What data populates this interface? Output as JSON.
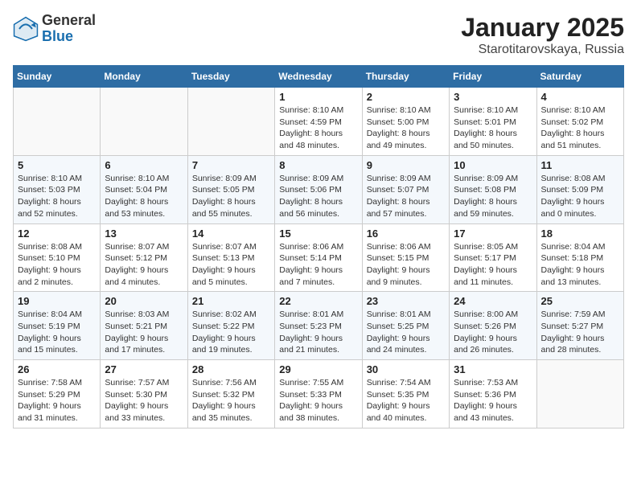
{
  "header": {
    "logo_general": "General",
    "logo_blue": "Blue",
    "month_title": "January 2025",
    "location": "Starotitarovskaya, Russia"
  },
  "weekdays": [
    "Sunday",
    "Monday",
    "Tuesday",
    "Wednesday",
    "Thursday",
    "Friday",
    "Saturday"
  ],
  "weeks": [
    [
      {
        "day": "",
        "info": ""
      },
      {
        "day": "",
        "info": ""
      },
      {
        "day": "",
        "info": ""
      },
      {
        "day": "1",
        "info": "Sunrise: 8:10 AM\nSunset: 4:59 PM\nDaylight: 8 hours\nand 48 minutes."
      },
      {
        "day": "2",
        "info": "Sunrise: 8:10 AM\nSunset: 5:00 PM\nDaylight: 8 hours\nand 49 minutes."
      },
      {
        "day": "3",
        "info": "Sunrise: 8:10 AM\nSunset: 5:01 PM\nDaylight: 8 hours\nand 50 minutes."
      },
      {
        "day": "4",
        "info": "Sunrise: 8:10 AM\nSunset: 5:02 PM\nDaylight: 8 hours\nand 51 minutes."
      }
    ],
    [
      {
        "day": "5",
        "info": "Sunrise: 8:10 AM\nSunset: 5:03 PM\nDaylight: 8 hours\nand 52 minutes."
      },
      {
        "day": "6",
        "info": "Sunrise: 8:10 AM\nSunset: 5:04 PM\nDaylight: 8 hours\nand 53 minutes."
      },
      {
        "day": "7",
        "info": "Sunrise: 8:09 AM\nSunset: 5:05 PM\nDaylight: 8 hours\nand 55 minutes."
      },
      {
        "day": "8",
        "info": "Sunrise: 8:09 AM\nSunset: 5:06 PM\nDaylight: 8 hours\nand 56 minutes."
      },
      {
        "day": "9",
        "info": "Sunrise: 8:09 AM\nSunset: 5:07 PM\nDaylight: 8 hours\nand 57 minutes."
      },
      {
        "day": "10",
        "info": "Sunrise: 8:09 AM\nSunset: 5:08 PM\nDaylight: 8 hours\nand 59 minutes."
      },
      {
        "day": "11",
        "info": "Sunrise: 8:08 AM\nSunset: 5:09 PM\nDaylight: 9 hours\nand 0 minutes."
      }
    ],
    [
      {
        "day": "12",
        "info": "Sunrise: 8:08 AM\nSunset: 5:10 PM\nDaylight: 9 hours\nand 2 minutes."
      },
      {
        "day": "13",
        "info": "Sunrise: 8:07 AM\nSunset: 5:12 PM\nDaylight: 9 hours\nand 4 minutes."
      },
      {
        "day": "14",
        "info": "Sunrise: 8:07 AM\nSunset: 5:13 PM\nDaylight: 9 hours\nand 5 minutes."
      },
      {
        "day": "15",
        "info": "Sunrise: 8:06 AM\nSunset: 5:14 PM\nDaylight: 9 hours\nand 7 minutes."
      },
      {
        "day": "16",
        "info": "Sunrise: 8:06 AM\nSunset: 5:15 PM\nDaylight: 9 hours\nand 9 minutes."
      },
      {
        "day": "17",
        "info": "Sunrise: 8:05 AM\nSunset: 5:17 PM\nDaylight: 9 hours\nand 11 minutes."
      },
      {
        "day": "18",
        "info": "Sunrise: 8:04 AM\nSunset: 5:18 PM\nDaylight: 9 hours\nand 13 minutes."
      }
    ],
    [
      {
        "day": "19",
        "info": "Sunrise: 8:04 AM\nSunset: 5:19 PM\nDaylight: 9 hours\nand 15 minutes."
      },
      {
        "day": "20",
        "info": "Sunrise: 8:03 AM\nSunset: 5:21 PM\nDaylight: 9 hours\nand 17 minutes."
      },
      {
        "day": "21",
        "info": "Sunrise: 8:02 AM\nSunset: 5:22 PM\nDaylight: 9 hours\nand 19 minutes."
      },
      {
        "day": "22",
        "info": "Sunrise: 8:01 AM\nSunset: 5:23 PM\nDaylight: 9 hours\nand 21 minutes."
      },
      {
        "day": "23",
        "info": "Sunrise: 8:01 AM\nSunset: 5:25 PM\nDaylight: 9 hours\nand 24 minutes."
      },
      {
        "day": "24",
        "info": "Sunrise: 8:00 AM\nSunset: 5:26 PM\nDaylight: 9 hours\nand 26 minutes."
      },
      {
        "day": "25",
        "info": "Sunrise: 7:59 AM\nSunset: 5:27 PM\nDaylight: 9 hours\nand 28 minutes."
      }
    ],
    [
      {
        "day": "26",
        "info": "Sunrise: 7:58 AM\nSunset: 5:29 PM\nDaylight: 9 hours\nand 31 minutes."
      },
      {
        "day": "27",
        "info": "Sunrise: 7:57 AM\nSunset: 5:30 PM\nDaylight: 9 hours\nand 33 minutes."
      },
      {
        "day": "28",
        "info": "Sunrise: 7:56 AM\nSunset: 5:32 PM\nDaylight: 9 hours\nand 35 minutes."
      },
      {
        "day": "29",
        "info": "Sunrise: 7:55 AM\nSunset: 5:33 PM\nDaylight: 9 hours\nand 38 minutes."
      },
      {
        "day": "30",
        "info": "Sunrise: 7:54 AM\nSunset: 5:35 PM\nDaylight: 9 hours\nand 40 minutes."
      },
      {
        "day": "31",
        "info": "Sunrise: 7:53 AM\nSunset: 5:36 PM\nDaylight: 9 hours\nand 43 minutes."
      },
      {
        "day": "",
        "info": ""
      }
    ]
  ]
}
